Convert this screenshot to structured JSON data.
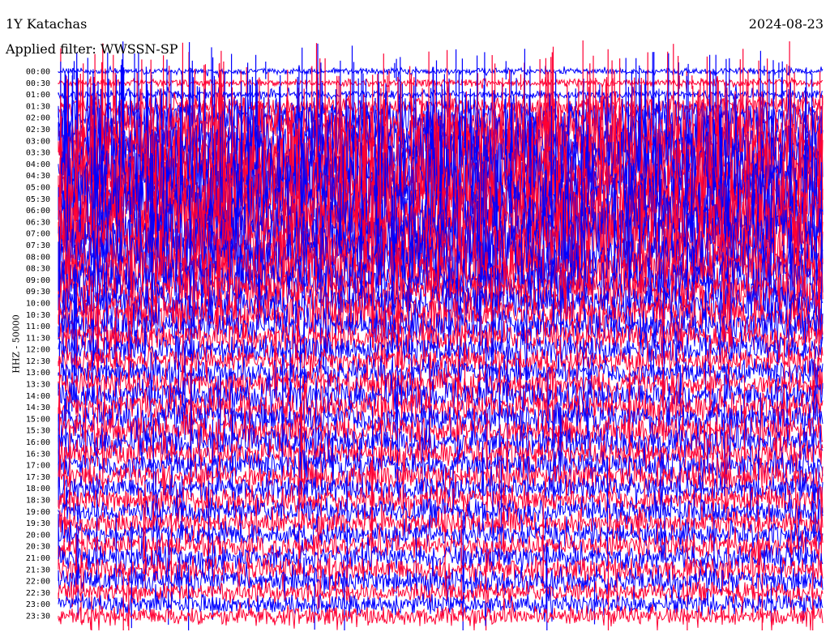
{
  "header": {
    "station": "1Y Katachas",
    "filter": "Applied filter: WWSSN-SP",
    "date": "2024-08-23"
  },
  "chart_data": {
    "type": "line",
    "title": "1Y Katachas",
    "subtitle": "Applied filter: WWSSN-SP",
    "ylabel": "HHZ - 50000",
    "colors": [
      "#0000ff",
      "#ff0033"
    ],
    "rows": [
      "00:00",
      "00:30",
      "01:00",
      "01:30",
      "02:00",
      "02:30",
      "03:00",
      "03:30",
      "04:00",
      "04:30",
      "05:00",
      "05:30",
      "06:00",
      "06:30",
      "07:00",
      "07:30",
      "08:00",
      "08:30",
      "09:00",
      "09:30",
      "10:00",
      "10:30",
      "11:00",
      "11:30",
      "12:00",
      "12:30",
      "13:00",
      "13:30",
      "14:00",
      "14:30",
      "15:00",
      "15:30",
      "16:00",
      "16:30",
      "17:00",
      "17:30",
      "18:00",
      "18:30",
      "19:00",
      "19:30",
      "20:00",
      "20:30",
      "21:00",
      "21:30",
      "22:00",
      "22:30",
      "23:00",
      "23:30"
    ],
    "relative_amplitude": [
      0.25,
      0.35,
      0.45,
      1.2,
      2.5,
      3.5,
      4,
      4.5,
      5,
      5,
      5,
      5,
      5,
      5,
      4.5,
      4.5,
      4,
      3.5,
      3,
      2.8,
      2.5,
      2.5,
      2.2,
      2,
      1.8,
      1.6,
      1.6,
      1.8,
      2,
      2,
      2,
      2,
      2,
      1.8,
      1.8,
      1.8,
      1.6,
      1.6,
      1.6,
      1.5,
      1.5,
      1.5,
      1.6,
      1.6,
      1.5,
      1.3,
      1.2,
      1.2
    ],
    "spikes_per_row": [
      8,
      10,
      12,
      18,
      30,
      40,
      45,
      50,
      50,
      50,
      45,
      45,
      40,
      40,
      35,
      35,
      30,
      25,
      20,
      18,
      15,
      15,
      12,
      12,
      10,
      10,
      10,
      10,
      10,
      10,
      10,
      10,
      10,
      10,
      10,
      10,
      8,
      8,
      8,
      8,
      8,
      8,
      8,
      8,
      8,
      6,
      6,
      6
    ]
  }
}
